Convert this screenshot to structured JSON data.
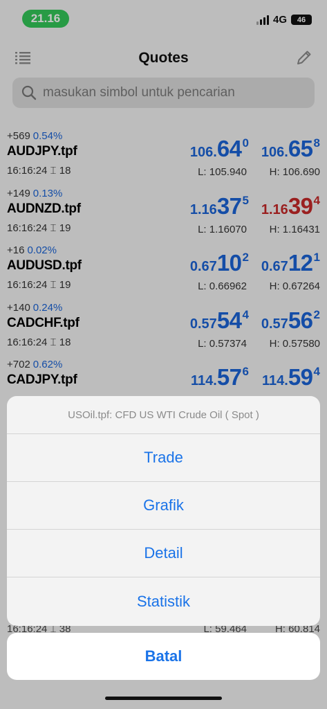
{
  "status": {
    "time": "21.16",
    "network": "4G",
    "battery": "46"
  },
  "header": {
    "title": "Quotes"
  },
  "search": {
    "placeholder": "masukan simbol untuk pencarian"
  },
  "quotes": [
    {
      "change": "+569",
      "pct": "0.54%",
      "symbol": "AUDJPY.tpf",
      "time": "16:16:24",
      "spread": "18",
      "bid": {
        "small": "106.",
        "big": "64",
        "sup": "0"
      },
      "ask": {
        "small": "106.",
        "big": "65",
        "sup": "8"
      },
      "low": "L: 105.940",
      "high": "H: 106.690",
      "ask_red": false
    },
    {
      "change": "+149",
      "pct": "0.13%",
      "symbol": "AUDNZD.tpf",
      "time": "16:16:24",
      "spread": "19",
      "bid": {
        "small": "1.16",
        "big": "37",
        "sup": "5"
      },
      "ask": {
        "small": "1.16",
        "big": "39",
        "sup": "4"
      },
      "low": "L: 1.16070",
      "high": "H: 1.16431",
      "ask_red": true
    },
    {
      "change": "+16",
      "pct": "0.02%",
      "symbol": "AUDUSD.tpf",
      "time": "16:16:24",
      "spread": "19",
      "bid": {
        "small": "0.67",
        "big": "10",
        "sup": "2"
      },
      "ask": {
        "small": "0.67",
        "big": "12",
        "sup": "1"
      },
      "low": "L: 0.66962",
      "high": "H: 0.67264",
      "ask_red": false
    },
    {
      "change": "+140",
      "pct": "0.24%",
      "symbol": "CADCHF.tpf",
      "time": "16:16:24",
      "spread": "18",
      "bid": {
        "small": "0.57",
        "big": "54",
        "sup": "4"
      },
      "ask": {
        "small": "0.57",
        "big": "56",
        "sup": "2"
      },
      "low": "L: 0.57374",
      "high": "H: 0.57580",
      "ask_red": false
    },
    {
      "change": "+702",
      "pct": "0.62%",
      "symbol": "CADJPY.tpf",
      "time": "",
      "spread": "",
      "bid": {
        "small": "114.",
        "big": "57",
        "sup": "6"
      },
      "ask": {
        "small": "114.",
        "big": "59",
        "sup": "4"
      },
      "low": "",
      "high": "",
      "ask_red": false
    }
  ],
  "peek_row": {
    "time": "16:16:24",
    "spread": "38",
    "low": "L: 59.464",
    "high": "H: 60.814"
  },
  "sheet": {
    "title": "USOil.tpf: CFD US WTI Crude Oil ( Spot )",
    "actions": [
      "Trade",
      "Grafik",
      "Detail",
      "Statistik"
    ],
    "cancel": "Batal"
  },
  "colors": {
    "blue": "#1a63d6",
    "red": "#c62828",
    "action": "#1a73e8",
    "pill": "#34c759"
  }
}
